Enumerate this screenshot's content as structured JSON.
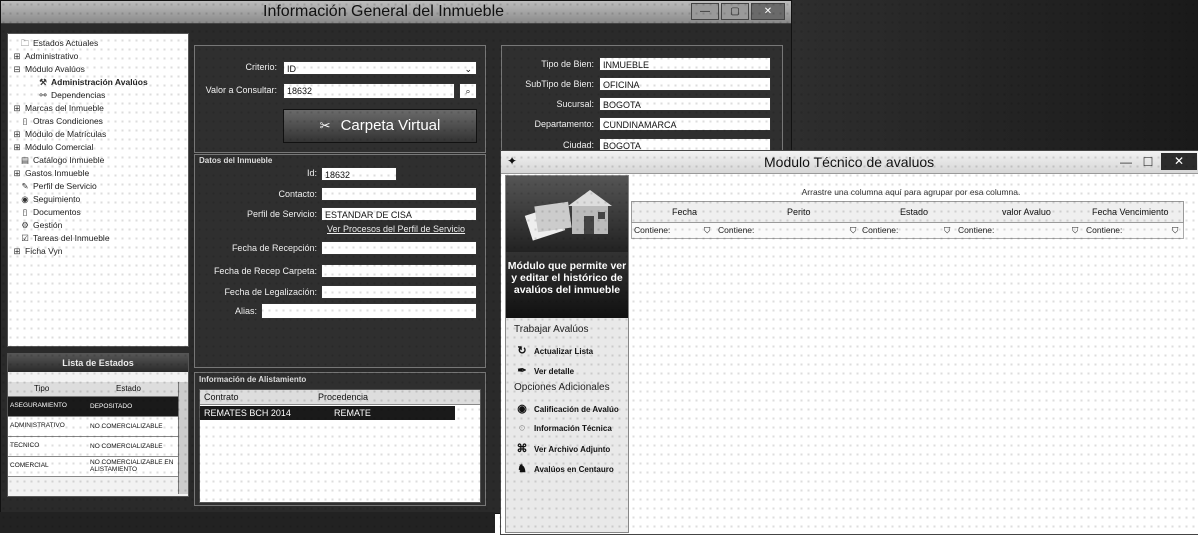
{
  "main_window": {
    "title": "Información General del Inmueble",
    "buttons": {
      "minimize": "—",
      "maximize": "▢",
      "close": "✕"
    }
  },
  "tree": [
    {
      "label": "Estados Actuales",
      "icon": "folder-icon"
    },
    {
      "label": "Administrativo",
      "icon": "plus-icon"
    },
    {
      "label": "Módulo Avalúos",
      "icon": "circle-icon"
    },
    {
      "label": "Administración Avalúos",
      "icon": "tool-icon"
    },
    {
      "label": "Dependencias",
      "icon": "link-icon"
    },
    {
      "label": "Marcas del Inmueble",
      "icon": "flag-icon"
    },
    {
      "label": "Otras Condiciones",
      "icon": "document-icon"
    },
    {
      "label": "Módulo de Matrículas",
      "icon": "book-icon"
    },
    {
      "label": "Módulo Comercial",
      "icon": "pen-icon"
    },
    {
      "label": "Catálogo Inmueble",
      "icon": "catalog-icon"
    },
    {
      "label": "Gastos Inmueble",
      "icon": "money-icon"
    },
    {
      "label": "Perfil de Servicio",
      "icon": "profile-icon"
    },
    {
      "label": "Seguimiento",
      "icon": "eye-icon"
    },
    {
      "label": "Documentos",
      "icon": "document-icon"
    },
    {
      "label": "Gestión",
      "icon": "gear-icon"
    },
    {
      "label": "Tareas del Inmueble",
      "icon": "task-icon"
    },
    {
      "label": "Ficha Vyn",
      "icon": "card-icon"
    }
  ],
  "estados": {
    "title": "Lista de Estados",
    "col_tipo": "Tipo",
    "col_estado": "Estado",
    "rows": [
      {
        "tipo": "ASEGURAMIENTO",
        "estado": "DEPOSITADO",
        "selected": true
      },
      {
        "tipo": "ADMINISTRATIVO",
        "estado": "NO COMERCIALIZABLE",
        "selected": false
      },
      {
        "tipo": "TÉCNICO",
        "estado": "NO COMERCIALIZABLE",
        "selected": false
      },
      {
        "tipo": "COMERCIAL",
        "estado": "NO COMERCIALIZABLE EN ALISTAMIENTO",
        "selected": false
      }
    ]
  },
  "consulta": {
    "criterio_label": "Criterio:",
    "criterio_value": "ID",
    "valor_label": "Valor a Consultar:",
    "valor_value": "18632",
    "carpeta_button": "Carpeta Virtual"
  },
  "datos": {
    "group_title": "Datos del Inmueble",
    "id_label": "Id:",
    "id_value": "18632",
    "contacto_label": "Contacto:",
    "contacto_value": "",
    "perfil_label": "Perfil de Servicio:",
    "perfil_value": "ESTANDAR DE CISA",
    "perfil_link": "Ver Procesos del Perfil de Servicio",
    "recepcion_label": "Fecha de Recepción:",
    "recep_carpeta_label": "Fecha de Recep Carpeta:",
    "legalizacion_label": "Fecha de Legalización:",
    "alias_label": "Alias:"
  },
  "alistamiento": {
    "group_title": "Información de Alistamiento",
    "col_contrato": "Contrato",
    "col_procedencia": "Procedencia",
    "row": {
      "contrato": "REMATES BCH 2014",
      "procedencia": "REMATE"
    }
  },
  "info": {
    "tipo_bien_label": "Tipo de Bien:",
    "tipo_bien_value": "INMUEBLE",
    "subtipo_label": "SubTipo de Bien:",
    "subtipo_value": "OFICINA",
    "sucursal_label": "Sucursal:",
    "sucursal_value": "BOGOTA",
    "departamento_label": "Departamento:",
    "departamento_value": "CUNDINAMARCA",
    "ciudad_label": "Ciudad:",
    "ciudad_value": "BOGOTA"
  },
  "avaluos_window": {
    "title": "Modulo Técnico de avaluos",
    "buttons": {
      "minimize": "—",
      "maximize": "☐",
      "close": "✕"
    },
    "side_text": "Módulo que permite ver y editar el histórico de avalúos del inmueble",
    "trabajar_label": "Trabajar Avalúos",
    "actions_trabajar": [
      {
        "label": "Actualizar Lista",
        "icon": "refresh-icon"
      },
      {
        "label": "Ver detalle",
        "icon": "pin-icon"
      }
    ],
    "opciones_label": "Opciones Adicionales",
    "actions_opciones": [
      {
        "label": "Calificación de Avalúo",
        "icon": "badge-icon"
      },
      {
        "label": "Información Técnica",
        "icon": "info-icon"
      },
      {
        "label": "Ver Archivo Adjunto",
        "icon": "attachment-icon"
      },
      {
        "label": "Avalúos en Centauro",
        "icon": "centaur-icon"
      }
    ],
    "group_hint": "Arrastre una columna aquí para agrupar por esa columna.",
    "columns": [
      "Fecha",
      "Perito",
      "Estado",
      "valor Avaluo",
      "Fecha Vencimiento"
    ],
    "filter_text": "Contiene:"
  }
}
